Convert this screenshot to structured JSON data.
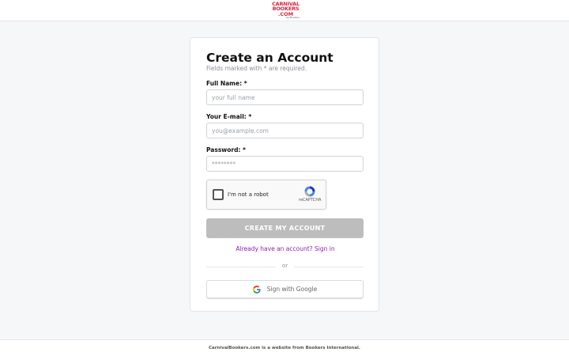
{
  "header": {
    "logo_line1": "CARNIVAL",
    "logo_line2": "BOOKERS",
    "logo_line3": ".COM",
    "logo_sub": "by Bookers"
  },
  "form": {
    "title": "Create an Account",
    "subtitle": "Fields marked with * are required.",
    "full_name": {
      "label": "Full Name: *",
      "placeholder": "your full name",
      "value": ""
    },
    "email": {
      "label": "Your E-mail: *",
      "placeholder": "you@example.com",
      "value": ""
    },
    "password": {
      "label": "Password: *",
      "placeholder": "********",
      "value": ""
    },
    "captcha": {
      "label": "I'm not a robot",
      "brand": "reCAPTCHA",
      "checked": false
    },
    "submit_label": "CREATE MY ACCOUNT",
    "signin_link": "Already have an account? Sign in",
    "divider_text": "or",
    "google_label": "Sign with Google"
  },
  "footer": {
    "text": "CarnivalBookers.com is a website from Bookers International."
  },
  "colors": {
    "brand": "#d7263d",
    "link": "#8e24aa",
    "button_disabled": "#bdbdbd"
  }
}
